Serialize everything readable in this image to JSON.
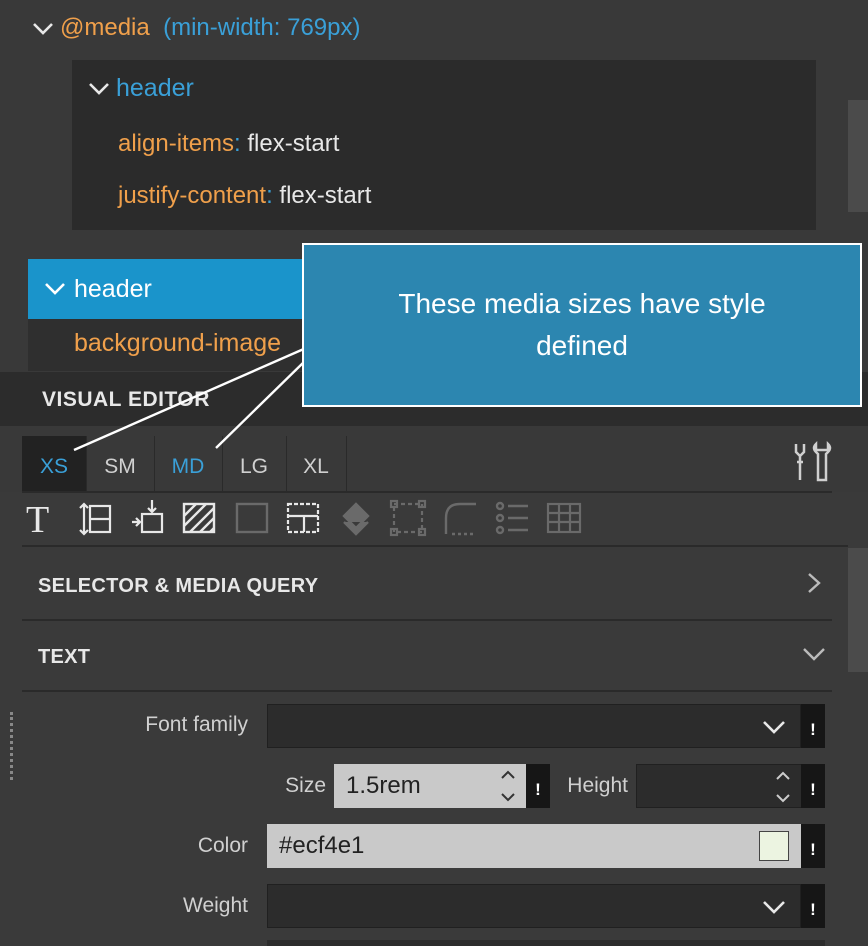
{
  "css_tree": {
    "media_keyword": "@media",
    "media_query": "(min-width: 769px)",
    "rule": {
      "selector": "header",
      "declarations": [
        {
          "property": "align-items",
          "value": "flex-start"
        },
        {
          "property": "justify-content",
          "value": "flex-start"
        }
      ]
    },
    "selected_rule": "header",
    "selected_declaration_property": "background-image"
  },
  "tooltip": {
    "line1": "These media sizes have style",
    "line2": "defined"
  },
  "visual_editor": {
    "title": "VISUAL EDITOR",
    "breakpoints": [
      {
        "label": "XS",
        "active": true,
        "has_style": true
      },
      {
        "label": "SM",
        "active": false,
        "has_style": false
      },
      {
        "label": "MD",
        "active": false,
        "has_style": true
      },
      {
        "label": "LG",
        "active": false,
        "has_style": false
      },
      {
        "label": "XL",
        "active": false,
        "has_style": false
      }
    ],
    "toolbar_icons": [
      "text-icon",
      "spacing-icon",
      "position-icon",
      "background-icon",
      "border-icon",
      "layout-icon",
      "flex-icon",
      "box-icon",
      "corner-radius-icon",
      "list-icon",
      "table-icon"
    ]
  },
  "sections": {
    "selector_media": "SELECTOR & MEDIA QUERY",
    "text": "TEXT"
  },
  "text_props": {
    "font_family_label": "Font family",
    "font_family_value": "",
    "size_label": "Size",
    "size_value": "1.5rem",
    "height_label": "Height",
    "height_value": "",
    "color_label": "Color",
    "color_value": "#ecf4e1",
    "weight_label": "Weight",
    "weight_value": "",
    "important_mark": "!"
  },
  "colors": {
    "accent": "#1a94cb",
    "property": "#f0a04b",
    "selector": "#3aa0d8",
    "tooltip_bg": "#2c86b0",
    "swatch": "#ecf4e1"
  }
}
